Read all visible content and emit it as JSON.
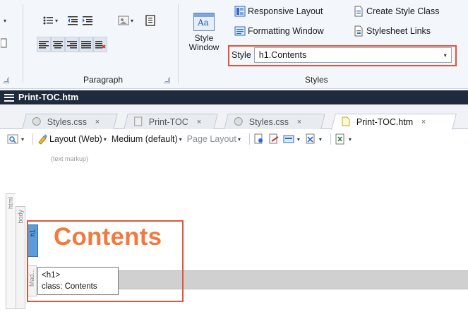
{
  "ribbon": {
    "paragraph_group_label": "Paragraph",
    "styles_group_label": "Styles",
    "style_window": {
      "line1": "Style",
      "line2": "Window"
    },
    "responsive_layout": "Responsive Layout",
    "create_style_class": "Create Style Class",
    "formatting_window": "Formatting Window",
    "stylesheet_links": "Stylesheet Links",
    "style_label": "Style",
    "style_value": "h1.Contents"
  },
  "document": {
    "title": "Print-TOC.htm"
  },
  "tabs": [
    {
      "label": "Styles.css",
      "close": "×"
    },
    {
      "label": "Print-TOC",
      "close": "×"
    },
    {
      "label": "Styles.css",
      "close": "×"
    },
    {
      "label": "Print-TOC.htm",
      "close": "×"
    }
  ],
  "viewbar": {
    "layout": "Layout (Web)",
    "medium": "Medium (default)",
    "page_layout": "Page Layout"
  },
  "editor": {
    "markup_label": "(text markup)",
    "structure": {
      "html": "html",
      "body": "body",
      "h1": "h1",
      "mad": "Mad..."
    },
    "heading_text": "Contents",
    "tooltip": {
      "line1": "<h1>",
      "line2": "class: Contents"
    }
  },
  "colors": {
    "accent_callout": "#e0553a",
    "heading": "#f07a3f",
    "docbar": "#1f2a3c",
    "h1_tag": "#5b9ddb"
  }
}
